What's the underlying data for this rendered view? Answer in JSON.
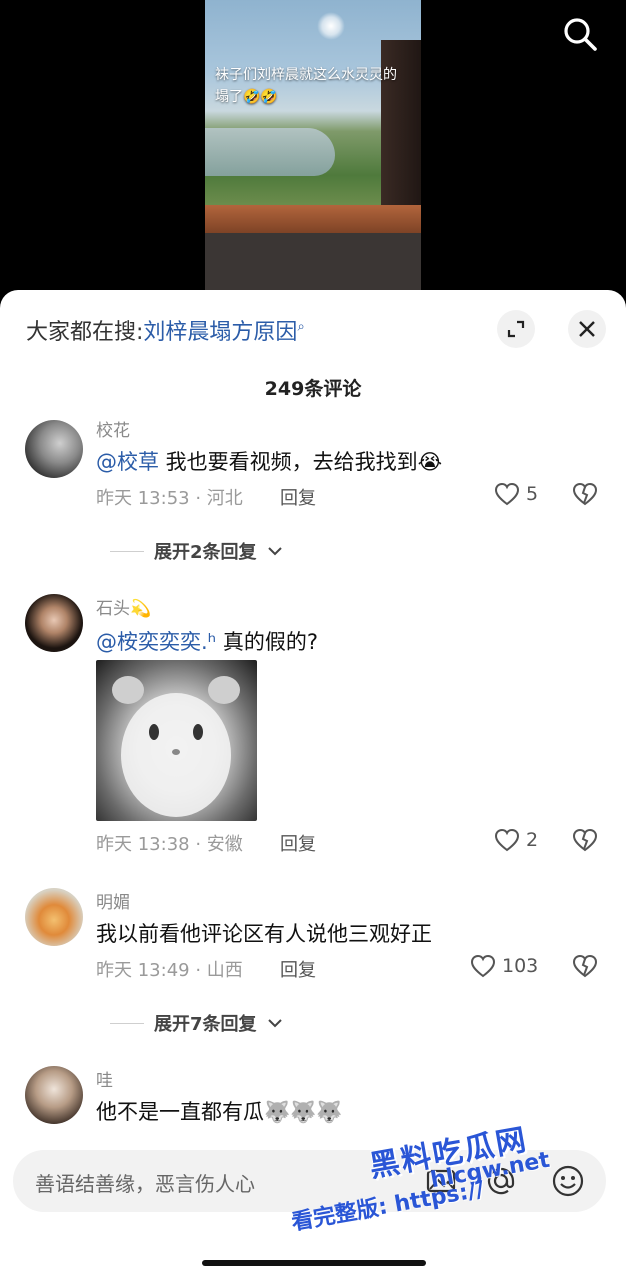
{
  "video": {
    "caption": "袜子们刘梓晨就这么水灵灵的塌了🤣🤣"
  },
  "trending": {
    "prefix": "大家都在搜:",
    "keyword": "刘梓晨塌方原因"
  },
  "comments_header": {
    "count_label": "249条评论"
  },
  "comments": [
    {
      "username": "校花",
      "mention": "@校草",
      "text": " 我也要看视频，去给我找到😭",
      "time_location": "昨天 13:53 · 河北",
      "reply_label": "回复",
      "likes": "5",
      "expand_label": "展开2条回复"
    },
    {
      "username": "石头💫",
      "mention": "@桉奕奕奕.ʰ",
      "text": " 真的假的?",
      "time_location": "昨天 13:38 · 安徽",
      "reply_label": "回复",
      "likes": "2"
    },
    {
      "username": "明媚",
      "text": "我以前看他评论区有人说他三观好正",
      "time_location": "昨天 13:49 · 山西",
      "reply_label": "回复",
      "likes": "103",
      "expand_label": "展开7条回复"
    },
    {
      "username": "哇",
      "text": "他不是一直都有瓜🐺🐺🐺"
    }
  ],
  "input": {
    "placeholder": "善语结善缘，恶言伤人心"
  },
  "watermark": {
    "line1": "黑料吃瓜网",
    "line2": "hlcgw.net",
    "line3": "看完整版: https://"
  },
  "colors": {
    "link": "#2b5ca8",
    "watermark": "#2a56d6"
  }
}
